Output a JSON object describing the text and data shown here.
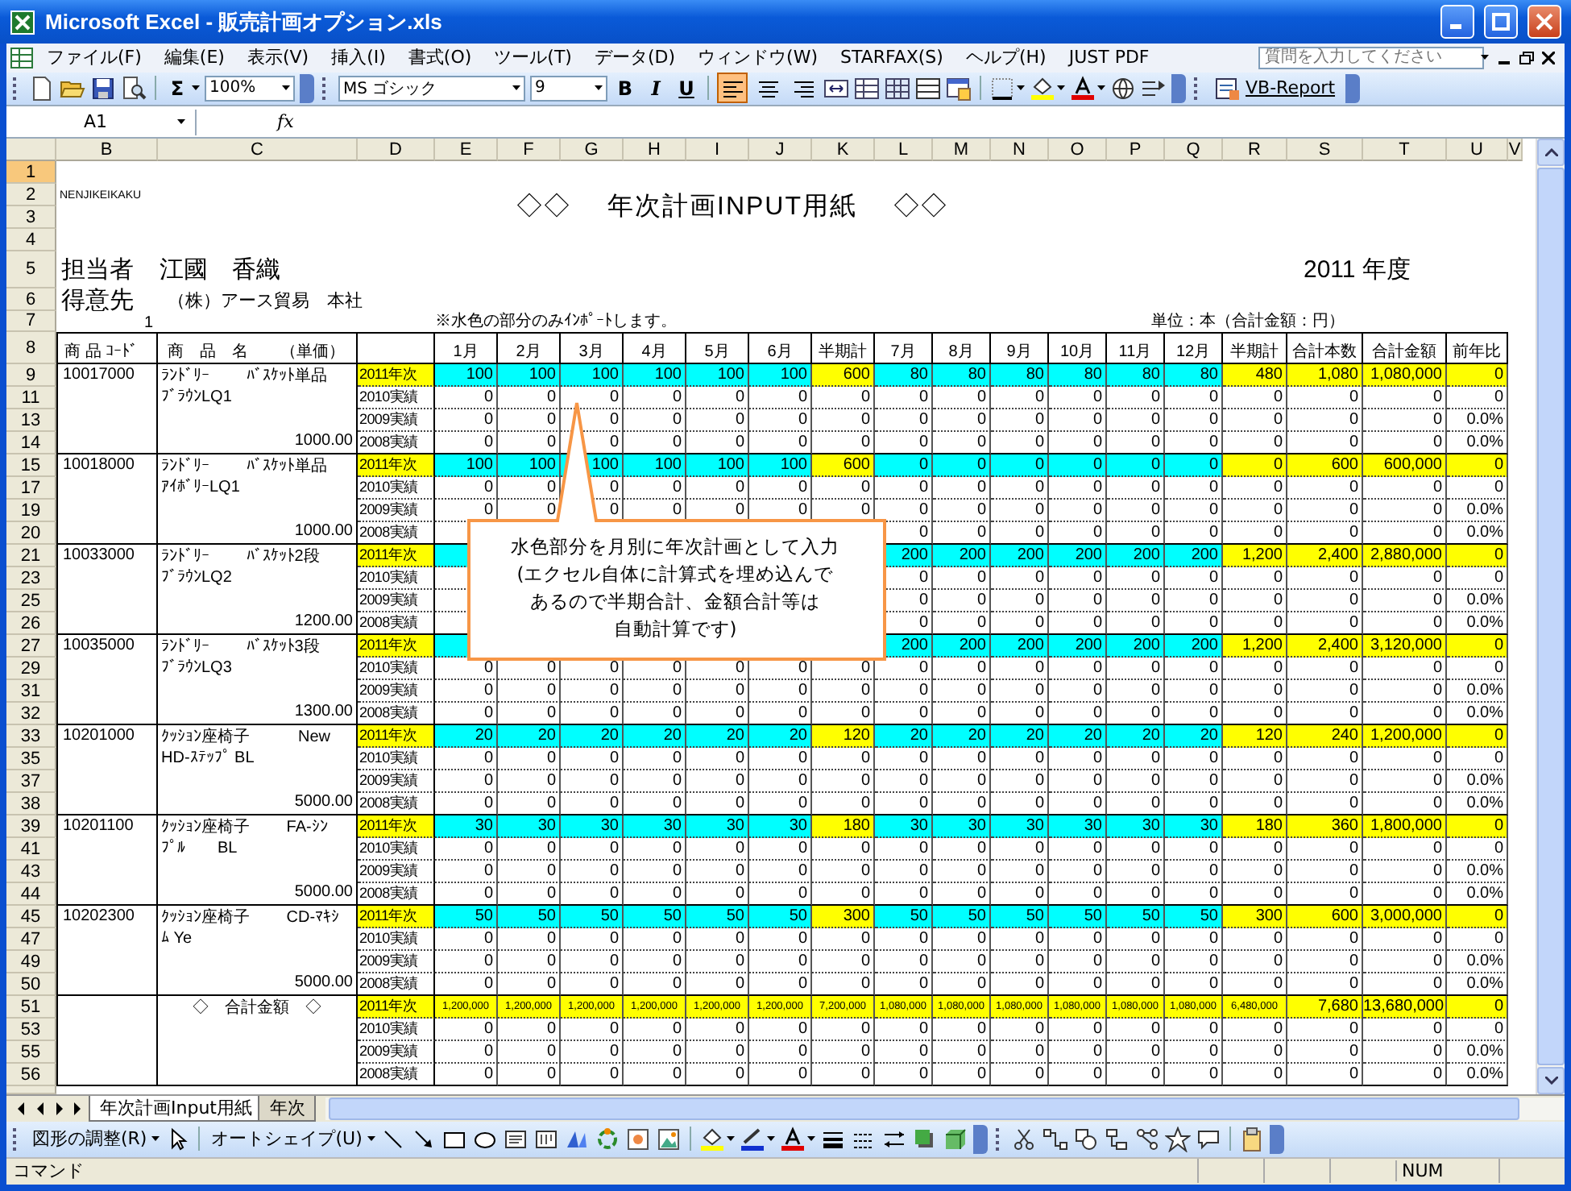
{
  "window": {
    "title": "Microsoft Excel - 販売計画オプション.xls"
  },
  "menu": [
    "ファイル(F)",
    "編集(E)",
    "表示(V)",
    "挿入(I)",
    "書式(O)",
    "ツール(T)",
    "データ(D)",
    "ウィンドウ(W)",
    "STARFAX(S)",
    "ヘルプ(H)",
    "JUST PDF"
  ],
  "help_box": {
    "placeholder": "質問を入力してください"
  },
  "toolbar": {
    "sum": "Σ",
    "zoom": "100%",
    "font": "MS ゴシック",
    "font_size": "9",
    "bold": "B",
    "italic": "I",
    "underline": "U",
    "align_buttons": [
      {
        "selected": true
      },
      {
        "selected": false
      },
      {
        "selected": false
      }
    ],
    "vb_report": "VB-Report"
  },
  "formula_bar": {
    "name_box": "A1",
    "fx": "fx"
  },
  "columns": [
    "B",
    "C",
    "D",
    "E",
    "F",
    "G",
    "H",
    "I",
    "J",
    "K",
    "L",
    "M",
    "N",
    "O",
    "P",
    "Q",
    "R",
    "S",
    "T",
    "U",
    "V"
  ],
  "top_rows": [
    {
      "row": "1",
      "selected": true
    },
    {
      "row": "2",
      "selected": false
    },
    {
      "row": "3",
      "selected": false
    },
    {
      "row": "4",
      "selected": false
    },
    {
      "row": "5",
      "selected": false
    },
    {
      "row": "6",
      "selected": false
    },
    {
      "row": "7",
      "selected": false
    },
    {
      "row": "8",
      "selected": false
    }
  ],
  "sheet": {
    "code_label": "NENJIKEIKAKU",
    "title": "◇◇　 年次計画INPUT用紙　 ◇◇",
    "person_label": "担当者",
    "person": "江國　香織",
    "year": "2011 年度",
    "customer_label": "得意先",
    "customer": "（株）アース貿易　本社",
    "row7_number": "1",
    "note": "※水色の部分のみｲﾝﾎﾟｰﾄします。",
    "unit": "単位：本（合計金額：円）",
    "header_code": "商 品 ｺｰﾄﾞ",
    "header_name": "商　品　名　　（単価）",
    "headers": [
      "1月",
      "2月",
      "3月",
      "4月",
      "5月",
      "6月",
      "半期計",
      "7月",
      "8月",
      "9月",
      "10月",
      "11月",
      "12月",
      "半期計",
      "合計本数",
      "合計金額",
      "前年比"
    ]
  },
  "groups": [
    {
      "kind": "product",
      "code": "10017000",
      "name_lines": [
        "ﾗﾝﾄﾞﾘｰ　　 ﾊﾞｽｹｯﾄ単品",
        "ﾌﾞﾗｳﾝLQ1"
      ],
      "price": "1000.00",
      "rows": [
        {
          "row": "9",
          "label": "2011年次",
          "kind": "plan",
          "values": [
            "100",
            "100",
            "100",
            "100",
            "100",
            "100",
            "600",
            "80",
            "80",
            "80",
            "80",
            "80",
            "80",
            "480",
            "1,080",
            "1,080,000",
            "0"
          ]
        },
        {
          "row": "11",
          "label": "2010実績",
          "kind": "actual",
          "values": [
            "0",
            "0",
            "0",
            "0",
            "0",
            "0",
            "0",
            "0",
            "0",
            "0",
            "0",
            "0",
            "0",
            "0",
            "0",
            "0",
            "0"
          ]
        },
        {
          "row": "13",
          "label": "2009実績",
          "kind": "actual",
          "values": [
            "0",
            "0",
            "0",
            "0",
            "0",
            "0",
            "0",
            "0",
            "0",
            "0",
            "0",
            "0",
            "0",
            "0",
            "0",
            "0",
            "0.0%"
          ]
        },
        {
          "row": "14",
          "label": "2008実績",
          "kind": "actual",
          "values": [
            "0",
            "0",
            "0",
            "0",
            "0",
            "0",
            "0",
            "0",
            "0",
            "0",
            "0",
            "0",
            "0",
            "0",
            "0",
            "0",
            "0.0%"
          ]
        }
      ]
    },
    {
      "kind": "product",
      "code": "10018000",
      "name_lines": [
        "ﾗﾝﾄﾞﾘｰ　　 ﾊﾞｽｹｯﾄ単品",
        "ｱｲﾎﾞﾘｰLQ1"
      ],
      "price": "1000.00",
      "rows": [
        {
          "row": "15",
          "label": "2011年次",
          "kind": "plan",
          "values": [
            "100",
            "100",
            "100",
            "100",
            "100",
            "100",
            "600",
            "0",
            "0",
            "0",
            "0",
            "0",
            "0",
            "0",
            "600",
            "600,000",
            "0"
          ]
        },
        {
          "row": "17",
          "label": "2010実績",
          "kind": "actual",
          "values": [
            "0",
            "0",
            "0",
            "0",
            "0",
            "0",
            "0",
            "0",
            "0",
            "0",
            "0",
            "0",
            "0",
            "0",
            "0",
            "0",
            "0"
          ]
        },
        {
          "row": "19",
          "label": "2009実績",
          "kind": "actual",
          "values": [
            "0",
            "0",
            "0",
            "0",
            "0",
            "0",
            "0",
            "0",
            "0",
            "0",
            "0",
            "0",
            "0",
            "0",
            "0",
            "0",
            "0.0%"
          ]
        },
        {
          "row": "20",
          "label": "2008実績",
          "kind": "actual",
          "cells": {
            "L": "0",
            "M": "0",
            "N": "0",
            "O": "0",
            "P": "0",
            "Q": "0",
            "R": "0",
            "S": "0",
            "T": "0",
            "U": "0.0%"
          }
        }
      ]
    },
    {
      "kind": "product",
      "code": "10033000",
      "name_lines": [
        "ﾗﾝﾄﾞﾘｰ　　 ﾊﾞｽｹｯﾄ2段",
        "ﾌﾞﾗｳﾝLQ2"
      ],
      "price": "1200.00",
      "rows": [
        {
          "row": "21",
          "label": "2011年次",
          "kind": "plan",
          "cells": {
            "L": "200",
            "M": "200",
            "N": "200",
            "O": "200",
            "P": "200",
            "Q": "200",
            "R": "1,200",
            "S": "2,400",
            "T": "2,880,000",
            "U": "0"
          }
        },
        {
          "row": "23",
          "label": "2010実績",
          "kind": "actual",
          "cells": {
            "L": "0",
            "M": "0",
            "N": "0",
            "O": "0",
            "P": "0",
            "Q": "0",
            "R": "0",
            "S": "0",
            "T": "0",
            "U": "0"
          }
        },
        {
          "row": "25",
          "label": "2009実績",
          "kind": "actual",
          "cells": {
            "L": "0",
            "M": "0",
            "N": "0",
            "O": "0",
            "P": "0",
            "Q": "0",
            "R": "0",
            "S": "0",
            "T": "0",
            "U": "0.0%"
          }
        },
        {
          "row": "26",
          "label": "2008実績",
          "kind": "actual",
          "cells": {
            "L": "0",
            "M": "0",
            "N": "0",
            "O": "0",
            "P": "0",
            "Q": "0",
            "R": "0",
            "S": "0",
            "T": "0",
            "U": "0.0%"
          }
        }
      ]
    },
    {
      "kind": "product",
      "code": "10035000",
      "name_lines": [
        "ﾗﾝﾄﾞﾘｰ　　 ﾊﾞｽｹｯﾄ3段",
        "ﾌﾞﾗｳﾝLQ3"
      ],
      "price": "1300.00",
      "rows": [
        {
          "row": "27",
          "label": "2011年次",
          "kind": "plan",
          "cells": {
            "L": "200",
            "M": "200",
            "N": "200",
            "O": "200",
            "P": "200",
            "Q": "200",
            "R": "1,200",
            "S": "2,400",
            "T": "3,120,000",
            "U": "0"
          }
        },
        {
          "row": "29",
          "label": "2010実績",
          "kind": "actual",
          "values": [
            "0",
            "0",
            "0",
            "0",
            "0",
            "0",
            "0",
            "0",
            "0",
            "0",
            "0",
            "0",
            "0",
            "0",
            "0",
            "0",
            "0"
          ]
        },
        {
          "row": "31",
          "label": "2009実績",
          "kind": "actual",
          "values": [
            "0",
            "0",
            "0",
            "0",
            "0",
            "0",
            "0",
            "0",
            "0",
            "0",
            "0",
            "0",
            "0",
            "0",
            "0",
            "0",
            "0.0%"
          ]
        },
        {
          "row": "32",
          "label": "2008実績",
          "kind": "actual",
          "values": [
            "0",
            "0",
            "0",
            "0",
            "0",
            "0",
            "0",
            "0",
            "0",
            "0",
            "0",
            "0",
            "0",
            "0",
            "0",
            "0",
            "0.0%"
          ]
        }
      ]
    },
    {
      "kind": "product",
      "code": "10201000",
      "name_lines": [
        "ｸｯｼｮﾝ座椅子　　　New",
        "HD-ｽﾃｯﾌﾟ BL"
      ],
      "price": "5000.00",
      "rows": [
        {
          "row": "33",
          "label": "2011年次",
          "kind": "plan",
          "values": [
            "20",
            "20",
            "20",
            "20",
            "20",
            "20",
            "120",
            "20",
            "20",
            "20",
            "20",
            "20",
            "20",
            "120",
            "240",
            "1,200,000",
            "0"
          ]
        },
        {
          "row": "35",
          "label": "2010実績",
          "kind": "actual",
          "values": [
            "0",
            "0",
            "0",
            "0",
            "0",
            "0",
            "0",
            "0",
            "0",
            "0",
            "0",
            "0",
            "0",
            "0",
            "0",
            "0",
            "0"
          ]
        },
        {
          "row": "37",
          "label": "2009実績",
          "kind": "actual",
          "values": [
            "0",
            "0",
            "0",
            "0",
            "0",
            "0",
            "0",
            "0",
            "0",
            "0",
            "0",
            "0",
            "0",
            "0",
            "0",
            "0",
            "0.0%"
          ]
        },
        {
          "row": "38",
          "label": "2008実績",
          "kind": "actual",
          "values": [
            "0",
            "0",
            "0",
            "0",
            "0",
            "0",
            "0",
            "0",
            "0",
            "0",
            "0",
            "0",
            "0",
            "0",
            "0",
            "0",
            "0.0%"
          ]
        }
      ]
    },
    {
      "kind": "product",
      "code": "10201100",
      "name_lines": [
        "ｸｯｼｮﾝ座椅子　　 FA-ｼﾝ",
        "ﾌﾟﾙ　　BL"
      ],
      "price": "5000.00",
      "rows": [
        {
          "row": "39",
          "label": "2011年次",
          "kind": "plan",
          "values": [
            "30",
            "30",
            "30",
            "30",
            "30",
            "30",
            "180",
            "30",
            "30",
            "30",
            "30",
            "30",
            "30",
            "180",
            "360",
            "1,800,000",
            "0"
          ]
        },
        {
          "row": "41",
          "label": "2010実績",
          "kind": "actual",
          "values": [
            "0",
            "0",
            "0",
            "0",
            "0",
            "0",
            "0",
            "0",
            "0",
            "0",
            "0",
            "0",
            "0",
            "0",
            "0",
            "0",
            "0"
          ]
        },
        {
          "row": "43",
          "label": "2009実績",
          "kind": "actual",
          "values": [
            "0",
            "0",
            "0",
            "0",
            "0",
            "0",
            "0",
            "0",
            "0",
            "0",
            "0",
            "0",
            "0",
            "0",
            "0",
            "0",
            "0.0%"
          ]
        },
        {
          "row": "44",
          "label": "2008実績",
          "kind": "actual",
          "values": [
            "0",
            "0",
            "0",
            "0",
            "0",
            "0",
            "0",
            "0",
            "0",
            "0",
            "0",
            "0",
            "0",
            "0",
            "0",
            "0",
            "0.0%"
          ]
        }
      ]
    },
    {
      "kind": "product",
      "code": "10202300",
      "name_lines": [
        "ｸｯｼｮﾝ座椅子　　 CD-ﾏｷｼ",
        "ﾑ Ye"
      ],
      "price": "5000.00",
      "rows": [
        {
          "row": "45",
          "label": "2011年次",
          "kind": "plan",
          "values": [
            "50",
            "50",
            "50",
            "50",
            "50",
            "50",
            "300",
            "50",
            "50",
            "50",
            "50",
            "50",
            "50",
            "300",
            "600",
            "3,000,000",
            "0"
          ]
        },
        {
          "row": "47",
          "label": "2010実績",
          "kind": "actual",
          "values": [
            "0",
            "0",
            "0",
            "0",
            "0",
            "0",
            "0",
            "0",
            "0",
            "0",
            "0",
            "0",
            "0",
            "0",
            "0",
            "0",
            "0"
          ]
        },
        {
          "row": "49",
          "label": "2009実績",
          "kind": "actual",
          "values": [
            "0",
            "0",
            "0",
            "0",
            "0",
            "0",
            "0",
            "0",
            "0",
            "0",
            "0",
            "0",
            "0",
            "0",
            "0",
            "0",
            "0.0%"
          ]
        },
        {
          "row": "50",
          "label": "2008実績",
          "kind": "actual",
          "values": [
            "0",
            "0",
            "0",
            "0",
            "0",
            "0",
            "0",
            "0",
            "0",
            "0",
            "0",
            "0",
            "0",
            "0",
            "0",
            "0",
            "0.0%"
          ]
        }
      ]
    },
    {
      "kind": "total",
      "name_lines": [
        "◇　合計金額　◇"
      ],
      "rows": [
        {
          "row": "51",
          "label": "2011年次",
          "kind": "total",
          "values": [
            "1,200,000",
            "1,200,000",
            "1,200,000",
            "1,200,000",
            "1,200,000",
            "1,200,000",
            "7,200,000",
            "1,080,000",
            "1,080,000",
            "1,080,000",
            "1,080,000",
            "1,080,000",
            "1,080,000",
            "6,480,000",
            "7,680",
            "13,680,000",
            "0"
          ]
        },
        {
          "row": "53",
          "label": "2010実績",
          "kind": "actual",
          "values": [
            "0",
            "0",
            "0",
            "0",
            "0",
            "0",
            "0",
            "0",
            "0",
            "0",
            "0",
            "0",
            "0",
            "0",
            "0",
            "0",
            "0"
          ]
        },
        {
          "row": "55",
          "label": "2009実績",
          "kind": "actual",
          "values": [
            "0",
            "0",
            "0",
            "0",
            "0",
            "0",
            "0",
            "0",
            "0",
            "0",
            "0",
            "0",
            "0",
            "0",
            "0",
            "0",
            "0.0%"
          ]
        },
        {
          "row": "56",
          "label": "2008実績",
          "kind": "actual",
          "values": [
            "0",
            "0",
            "0",
            "0",
            "0",
            "0",
            "0",
            "0",
            "0",
            "0",
            "0",
            "0",
            "0",
            "0",
            "0",
            "0",
            "0.0%"
          ]
        }
      ]
    }
  ],
  "callout": {
    "lines": [
      "水色部分を月別に年次計画として入力",
      "(エクセル自体に計算式を埋め込んで",
      "あるので半期合計、金額合計等は",
      "自動計算です)"
    ]
  },
  "sheet_tabs": [
    {
      "label": "年次計画Input用紙",
      "selected": true
    },
    {
      "label": "年次",
      "selected": false
    }
  ],
  "drawing_toolbar": {
    "arrange": "図形の調整(R)",
    "autoshape": "オートシェイプ(U)"
  },
  "status_bar": {
    "mode": "コマンド",
    "num": "NUM"
  }
}
